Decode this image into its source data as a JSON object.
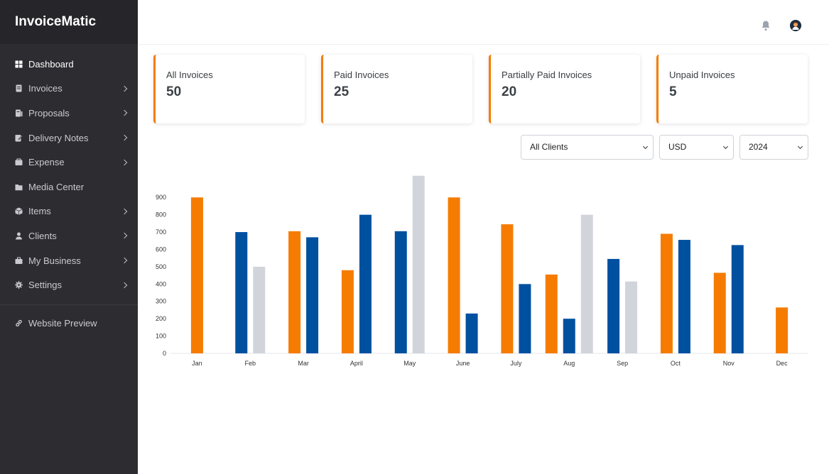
{
  "app": {
    "title": "InvoiceMatic"
  },
  "sidebar": {
    "items": [
      {
        "label": "Dashboard",
        "icon": "dashboard-icon",
        "chevron": false
      },
      {
        "label": "Invoices",
        "icon": "invoice-icon",
        "chevron": true
      },
      {
        "label": "Proposals",
        "icon": "proposal-icon",
        "chevron": true
      },
      {
        "label": "Delivery Notes",
        "icon": "delivery-note-icon",
        "chevron": true
      },
      {
        "label": "Expense",
        "icon": "wallet-icon",
        "chevron": true
      },
      {
        "label": "Media Center",
        "icon": "folder-icon",
        "chevron": false
      },
      {
        "label": "Items",
        "icon": "box-icon",
        "chevron": true
      },
      {
        "label": "Clients",
        "icon": "user-icon",
        "chevron": true
      },
      {
        "label": "My Business",
        "icon": "briefcase-icon",
        "chevron": true
      },
      {
        "label": "Settings",
        "icon": "gear-icon",
        "chevron": true
      }
    ],
    "footer_item": {
      "label": "Website Preview",
      "icon": "link-icon"
    }
  },
  "cards": [
    {
      "label": "All Invoices",
      "value": "50"
    },
    {
      "label": "Paid Invoices",
      "value": "25"
    },
    {
      "label": "Partially Paid Invoices",
      "value": "20"
    },
    {
      "label": "Unpaid Invoices",
      "value": "5"
    }
  ],
  "filters": {
    "client": "All Clients",
    "currency": "USD",
    "year": "2024"
  },
  "colors": {
    "accent": "#f57c00",
    "series_orange": "#f57c00",
    "series_blue": "#0050a0",
    "series_gray": "#d1d5db"
  },
  "chart_data": {
    "type": "bar",
    "categories": [
      "Jan",
      "Feb",
      "Mar",
      "April",
      "May",
      "June",
      "July",
      "Aug",
      "Sep",
      "Oct",
      "Nov",
      "Dec"
    ],
    "series": [
      {
        "color": "#f57c00",
        "values": [
          900,
          0,
          705,
          480,
          0,
          900,
          745,
          455,
          0,
          690,
          465,
          265
        ]
      },
      {
        "color": "#0050a0",
        "values": [
          0,
          700,
          670,
          800,
          705,
          230,
          400,
          200,
          545,
          655,
          625,
          0
        ]
      },
      {
        "color": "#d1d5db",
        "values": [
          0,
          500,
          0,
          0,
          1025,
          0,
          0,
          800,
          415,
          0,
          0,
          0
        ]
      }
    ],
    "yticks": [
      0,
      100,
      200,
      300,
      400,
      500,
      600,
      700,
      800,
      900
    ],
    "ylim": [
      0,
      900
    ],
    "grid": false
  }
}
